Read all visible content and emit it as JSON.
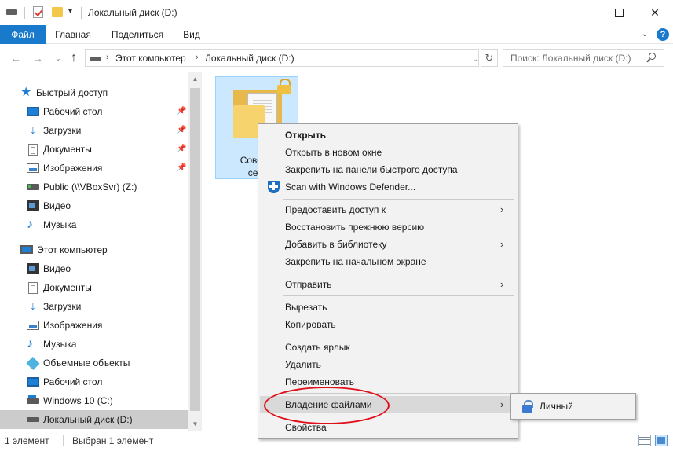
{
  "window": {
    "title": "Локальный диск (D:)",
    "minimize_glyph": "",
    "maximize_glyph": "",
    "close_glyph": "✕",
    "qa_arrow": "▾"
  },
  "ribbon": {
    "tabs": [
      "Файл",
      "Главная",
      "Поделиться",
      "Вид"
    ],
    "expand_glyph": "⌄",
    "help_glyph": "?"
  },
  "address": {
    "breadcrumbs": [
      "Этот компьютер",
      "Локальный диск (D:)"
    ],
    "crumb_sep": "›",
    "back_glyph": "←",
    "forward_glyph": "→",
    "history_glyph": "⌄",
    "up_glyph": "↑",
    "dropdown_glyph": "⌄",
    "refresh_glyph": "↻",
    "search_placeholder": "Поиск: Локальный диск (D:)"
  },
  "sidebar": {
    "quick_access": {
      "label": "Быстрый доступ",
      "items": [
        {
          "label": "Рабочий стол",
          "pinned": true
        },
        {
          "label": "Загрузки",
          "pinned": true
        },
        {
          "label": "Документы",
          "pinned": true
        },
        {
          "label": "Изображения",
          "pinned": true
        },
        {
          "label": "Public (\\\\VBoxSvr) (Z:)",
          "pinned": false
        },
        {
          "label": "Видео",
          "pinned": false
        },
        {
          "label": "Музыка",
          "pinned": false
        }
      ]
    },
    "this_pc": {
      "label": "Этот компьютер",
      "items": [
        {
          "label": "Видео"
        },
        {
          "label": "Документы"
        },
        {
          "label": "Загрузки"
        },
        {
          "label": "Изображения"
        },
        {
          "label": "Музыка"
        },
        {
          "label": "Объемные объекты"
        },
        {
          "label": "Рабочий стол"
        },
        {
          "label": "Windows 10 (C:)"
        },
        {
          "label": "Локальный диск (D:)"
        }
      ]
    },
    "pin_glyph": "📌",
    "scroll_up_glyph": "▲",
    "scroll_down_glyph": "▼"
  },
  "content": {
    "file": {
      "name_line1": "Соверш",
      "name_line2": "секр"
    }
  },
  "context_menu": {
    "items": [
      {
        "label": "Открыть",
        "bold": true
      },
      {
        "label": "Открыть в новом окне"
      },
      {
        "label": "Закрепить на панели быстрого доступа"
      },
      {
        "label": "Scan with Windows Defender..."
      },
      {
        "label": "Предоставить доступ к",
        "submenu": true
      },
      {
        "label": "Восстановить прежнюю версию"
      },
      {
        "label": "Добавить в библиотеку",
        "submenu": true
      },
      {
        "label": "Закрепить на начальном экране"
      },
      {
        "label": "Отправить",
        "submenu": true
      },
      {
        "label": "Вырезать"
      },
      {
        "label": "Копировать"
      },
      {
        "label": "Создать ярлык"
      },
      {
        "label": "Удалить"
      },
      {
        "label": "Переименовать"
      },
      {
        "label": "Владение файлами",
        "submenu": true,
        "highlighted": true
      },
      {
        "label": "Свойства"
      }
    ],
    "arrow_glyph": "›",
    "highlight_color": "#e0101a"
  },
  "submenu": {
    "items": [
      {
        "label": "Личный"
      }
    ]
  },
  "status": {
    "count": "1 элемент",
    "selected": "Выбран 1 элемент"
  },
  "colors": {
    "accent": "#1979ca",
    "selection": "#cce8ff"
  }
}
